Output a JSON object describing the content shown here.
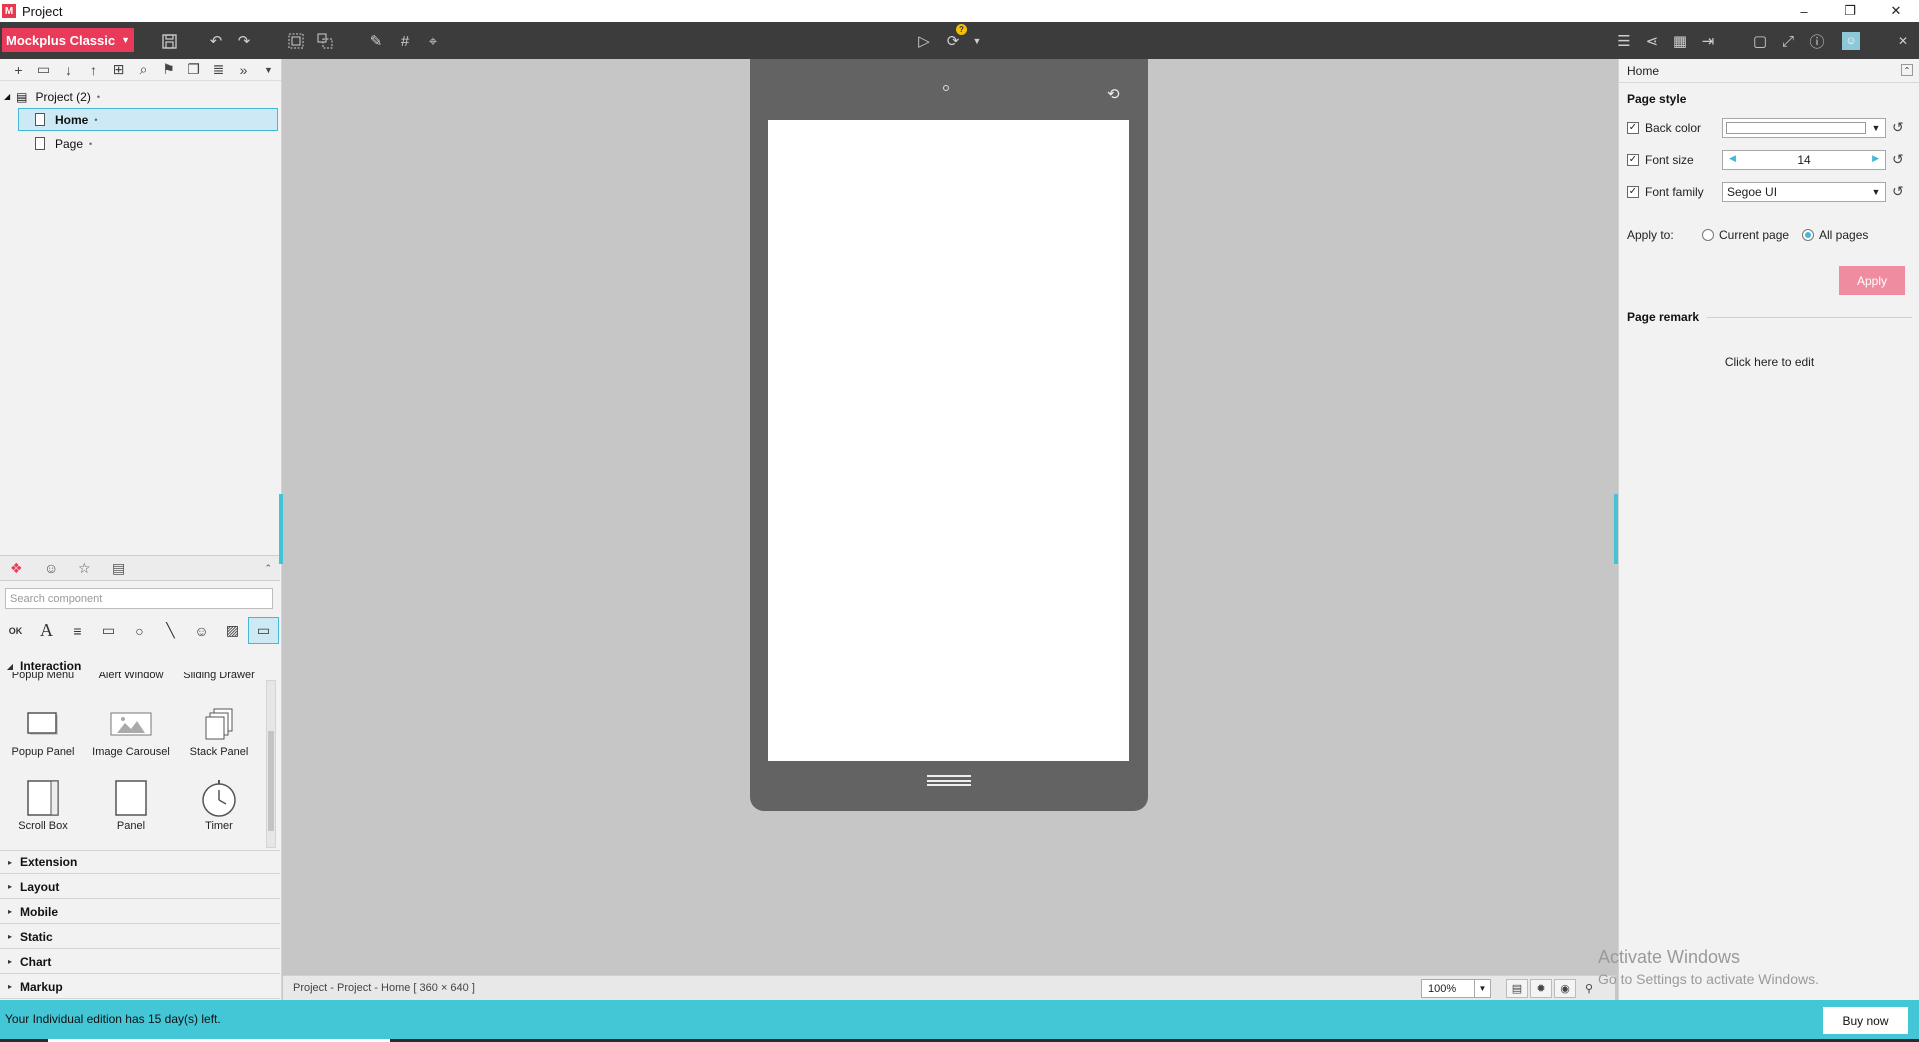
{
  "window": {
    "title": "Project",
    "logo": "M",
    "minimize": "–",
    "restore": "❐",
    "close": "✕"
  },
  "toolbar": {
    "brand_label": "Mockplus Classic",
    "badge": "?",
    "icons_left": [
      "save-icon",
      "undo-icon",
      "redo-icon",
      "group-icon",
      "ungroup-icon",
      "format-brush-icon",
      "grid-icon",
      "pointer-icon"
    ],
    "icons_center": [
      "preview-play-icon",
      "sync-icon"
    ],
    "icons_right": [
      "export-icon",
      "share-icon",
      "gallery-icon",
      "import-icon",
      "fullscreen-icon",
      "fit-icon",
      "help-icon",
      "profile-icon"
    ]
  },
  "project_tree": {
    "root_label": "Project (2)",
    "root_marker": "•",
    "pages": [
      {
        "label": "Home",
        "marker": "•",
        "selected": true
      },
      {
        "label": "Page",
        "marker": "•",
        "selected": false
      }
    ]
  },
  "components": {
    "search_placeholder": "Search component",
    "open_category": "Interaction",
    "partial_row": [
      "Popup Menu",
      "Alert Window",
      "Sliding Drawer"
    ],
    "items": [
      {
        "label": "Popup Panel",
        "icon": "popup-panel-icon"
      },
      {
        "label": "Image Carousel",
        "icon": "image-carousel-icon"
      },
      {
        "label": "Stack Panel",
        "icon": "stack-panel-icon"
      },
      {
        "label": "Scroll Box",
        "icon": "scroll-box-icon"
      },
      {
        "label": "Panel",
        "icon": "panel-icon"
      },
      {
        "label": "Timer",
        "icon": "timer-icon"
      }
    ],
    "categories": [
      "Extension",
      "Layout",
      "Mobile",
      "Static",
      "Chart",
      "Markup"
    ]
  },
  "canvas": {
    "status_text": "Project - Project - Home [ 360 × 640 ]",
    "zoom": "100%"
  },
  "properties": {
    "header": "Home",
    "page_style_title": "Page style",
    "back_color_label": "Back color",
    "back_color_value": "#ffffff",
    "font_size_label": "Font size",
    "font_size_value": "14",
    "font_family_label": "Font family",
    "font_family_value": "Segoe UI",
    "apply_to_label": "Apply to:",
    "apply_options": [
      "Current page",
      "All pages"
    ],
    "apply_selected": "All pages",
    "apply_button": "Apply",
    "page_remark_title": "Page remark",
    "remark_placeholder": "Click here to edit"
  },
  "watermark": {
    "line1": "Activate Windows",
    "line2": "Go to Settings to activate Windows."
  },
  "footer": {
    "trial_text": "Your Individual edition has 15 day(s) left.",
    "buy_label": "Buy now"
  },
  "colors": {
    "brand": "#ea3a5a",
    "accent": "#43c6d6",
    "apply": "#f08ca0",
    "device": "#636363"
  }
}
